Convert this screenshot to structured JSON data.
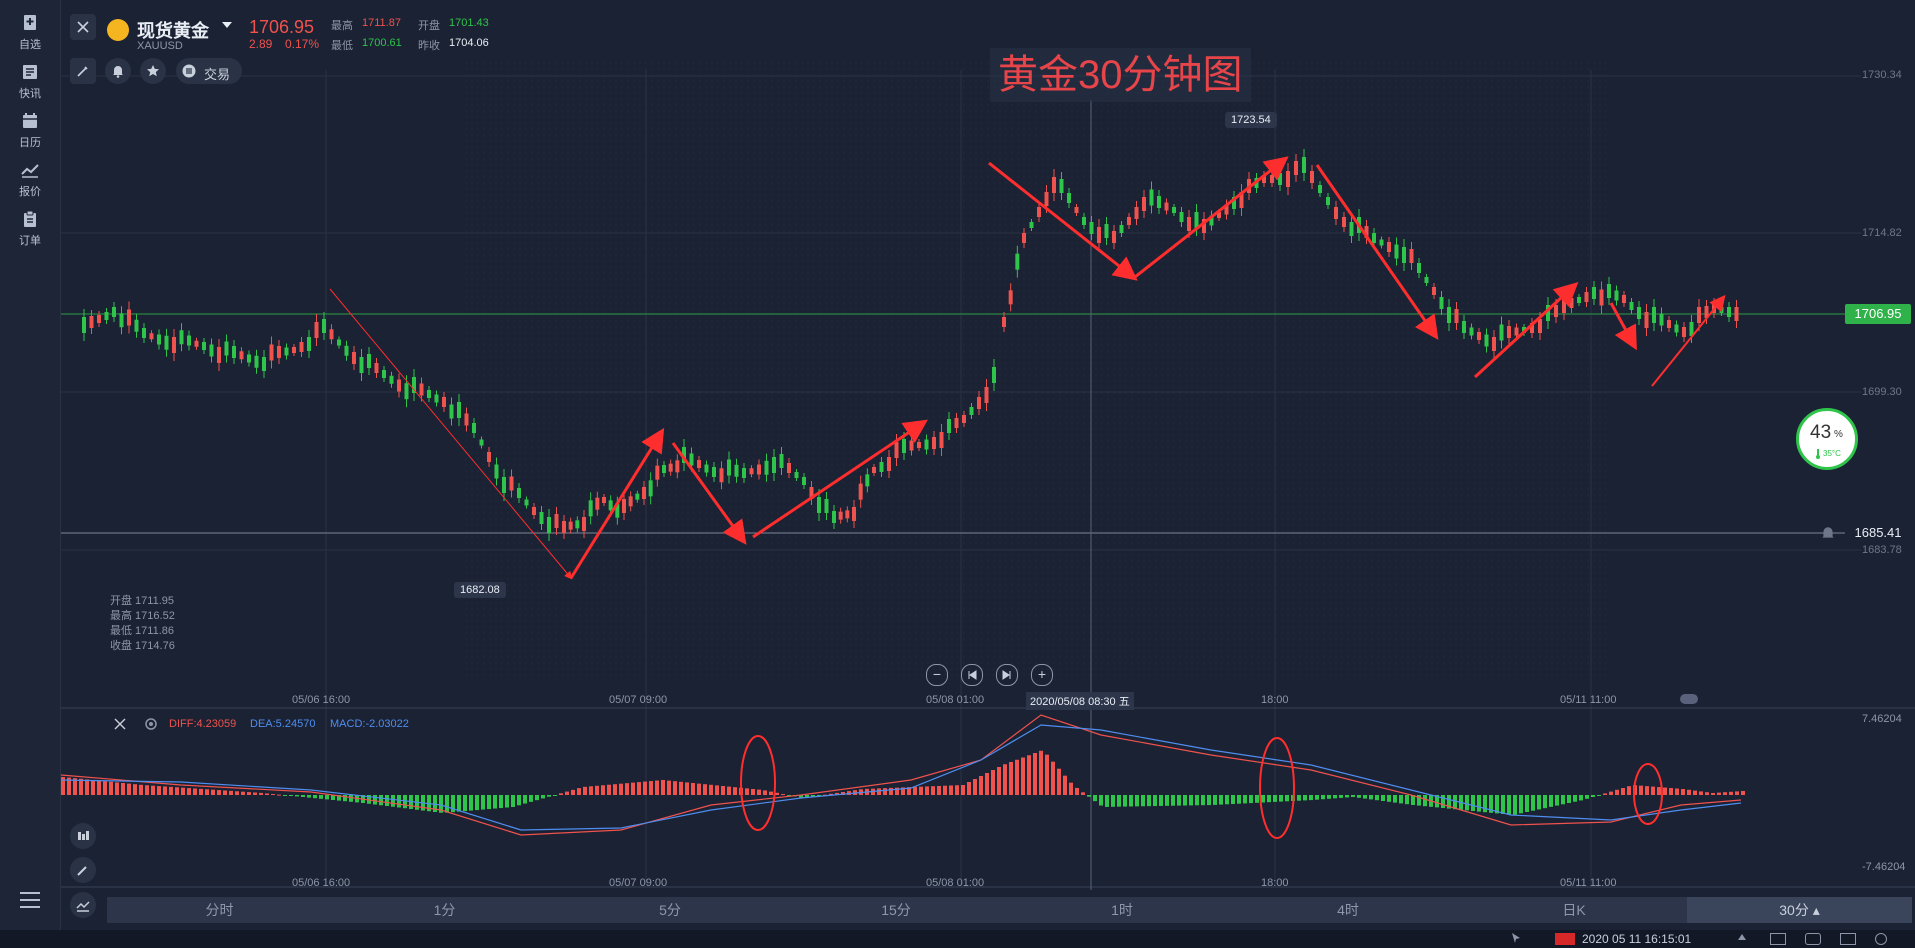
{
  "sidebar": {
    "items": [
      {
        "label": "自选",
        "icon": "bookmark-add-icon"
      },
      {
        "label": "快讯",
        "icon": "news-icon"
      },
      {
        "label": "日历",
        "icon": "calendar-icon"
      },
      {
        "label": "报价",
        "icon": "quote-chart-icon"
      },
      {
        "label": "订单",
        "icon": "order-clipboard-icon"
      }
    ]
  },
  "header": {
    "symbol_name": "现货黄金",
    "symbol_code": "XAUUSD",
    "price": "1706.95",
    "change": "2.89",
    "change_pct": "0.17%",
    "high_label": "最高",
    "high": "1711.87",
    "low_label": "最低",
    "low": "1700.61",
    "open_label": "开盘",
    "open": "1701.43",
    "prev_close_label": "昨收",
    "prev_close": "1704.06",
    "trade_label": "交易"
  },
  "chart_title": "黄金30分钟图",
  "price_axis": {
    "ticks": [
      "1730.34",
      "1714.82",
      "1699.30",
      "1683.78"
    ],
    "current_price_tag": "1706.95",
    "alert_price_tag": "1685.41"
  },
  "markers": {
    "high_marker": "1723.54",
    "low_marker": "1682.08"
  },
  "ohlc_panel": {
    "open": "开盘 1711.95",
    "high": "最高 1716.52",
    "low": "最低 1711.86",
    "close": "收盘 1714.76"
  },
  "time_axis": {
    "labels": [
      "05/06 16:00",
      "05/07 09:00",
      "05/08 01:00",
      "18:00",
      "05/11 11:00"
    ],
    "crosshair_time": "2020/05/08 08:30 五"
  },
  "macd": {
    "diff": "DIFF:4.23059",
    "dea": "DEA:5.24570",
    "macd": "MACD:-2.03022",
    "axis_top": "7.46204",
    "axis_bottom": "-7.46204"
  },
  "gauge": {
    "value": "43",
    "unit": "%",
    "temp": "35°C"
  },
  "timeframes": [
    "分时",
    "1分",
    "5分",
    "15分",
    "1时",
    "4时",
    "日K",
    "30分 ▴"
  ],
  "status_bar": {
    "datetime": "2020  05  11  16:15:01"
  },
  "colors": {
    "up": "#f0524d",
    "down": "#2fc44a",
    "background": "#1b2233",
    "annotation": "#ff2e2e",
    "title": "#e8454a"
  }
}
